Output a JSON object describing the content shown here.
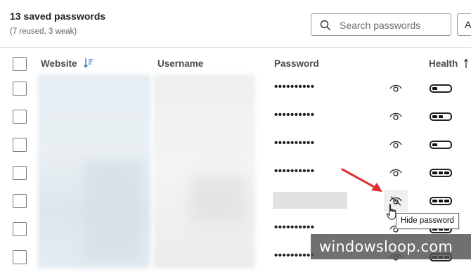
{
  "summary": {
    "title": "13 saved passwords",
    "subtitle": "(7 reused, 3 weak)"
  },
  "search": {
    "placeholder": "Search passwords"
  },
  "add_button_label": "A",
  "table": {
    "columns": {
      "website": "Website",
      "username": "Username",
      "password": "Password",
      "health": "Health"
    },
    "rows": [
      {
        "password": "••••••••••",
        "revealed": false,
        "health_level": 1
      },
      {
        "password": "••••••••••",
        "revealed": false,
        "health_level": 2
      },
      {
        "password": "••••••••••",
        "revealed": false,
        "health_level": 1
      },
      {
        "password": "••••••••••",
        "revealed": false,
        "health_level": 3
      },
      {
        "password": "",
        "revealed": true,
        "health_level": 3
      },
      {
        "password": "••••••••••",
        "revealed": false,
        "health_level": 3
      },
      {
        "password": "••••••••••",
        "revealed": false,
        "health_level": 3
      }
    ]
  },
  "tooltip": "Hide password",
  "watermark": "windowsloop.com",
  "colors": {
    "annotation_arrow": "#e03131",
    "health_bar": "#111111"
  },
  "icons": {
    "search": "search-icon",
    "sort_website": "sort-descending-icon",
    "sort_health": "sort-ascending-icon",
    "reveal": "eye-icon",
    "health": "health-meter-icon",
    "cursor": "hand-pointer-icon"
  }
}
